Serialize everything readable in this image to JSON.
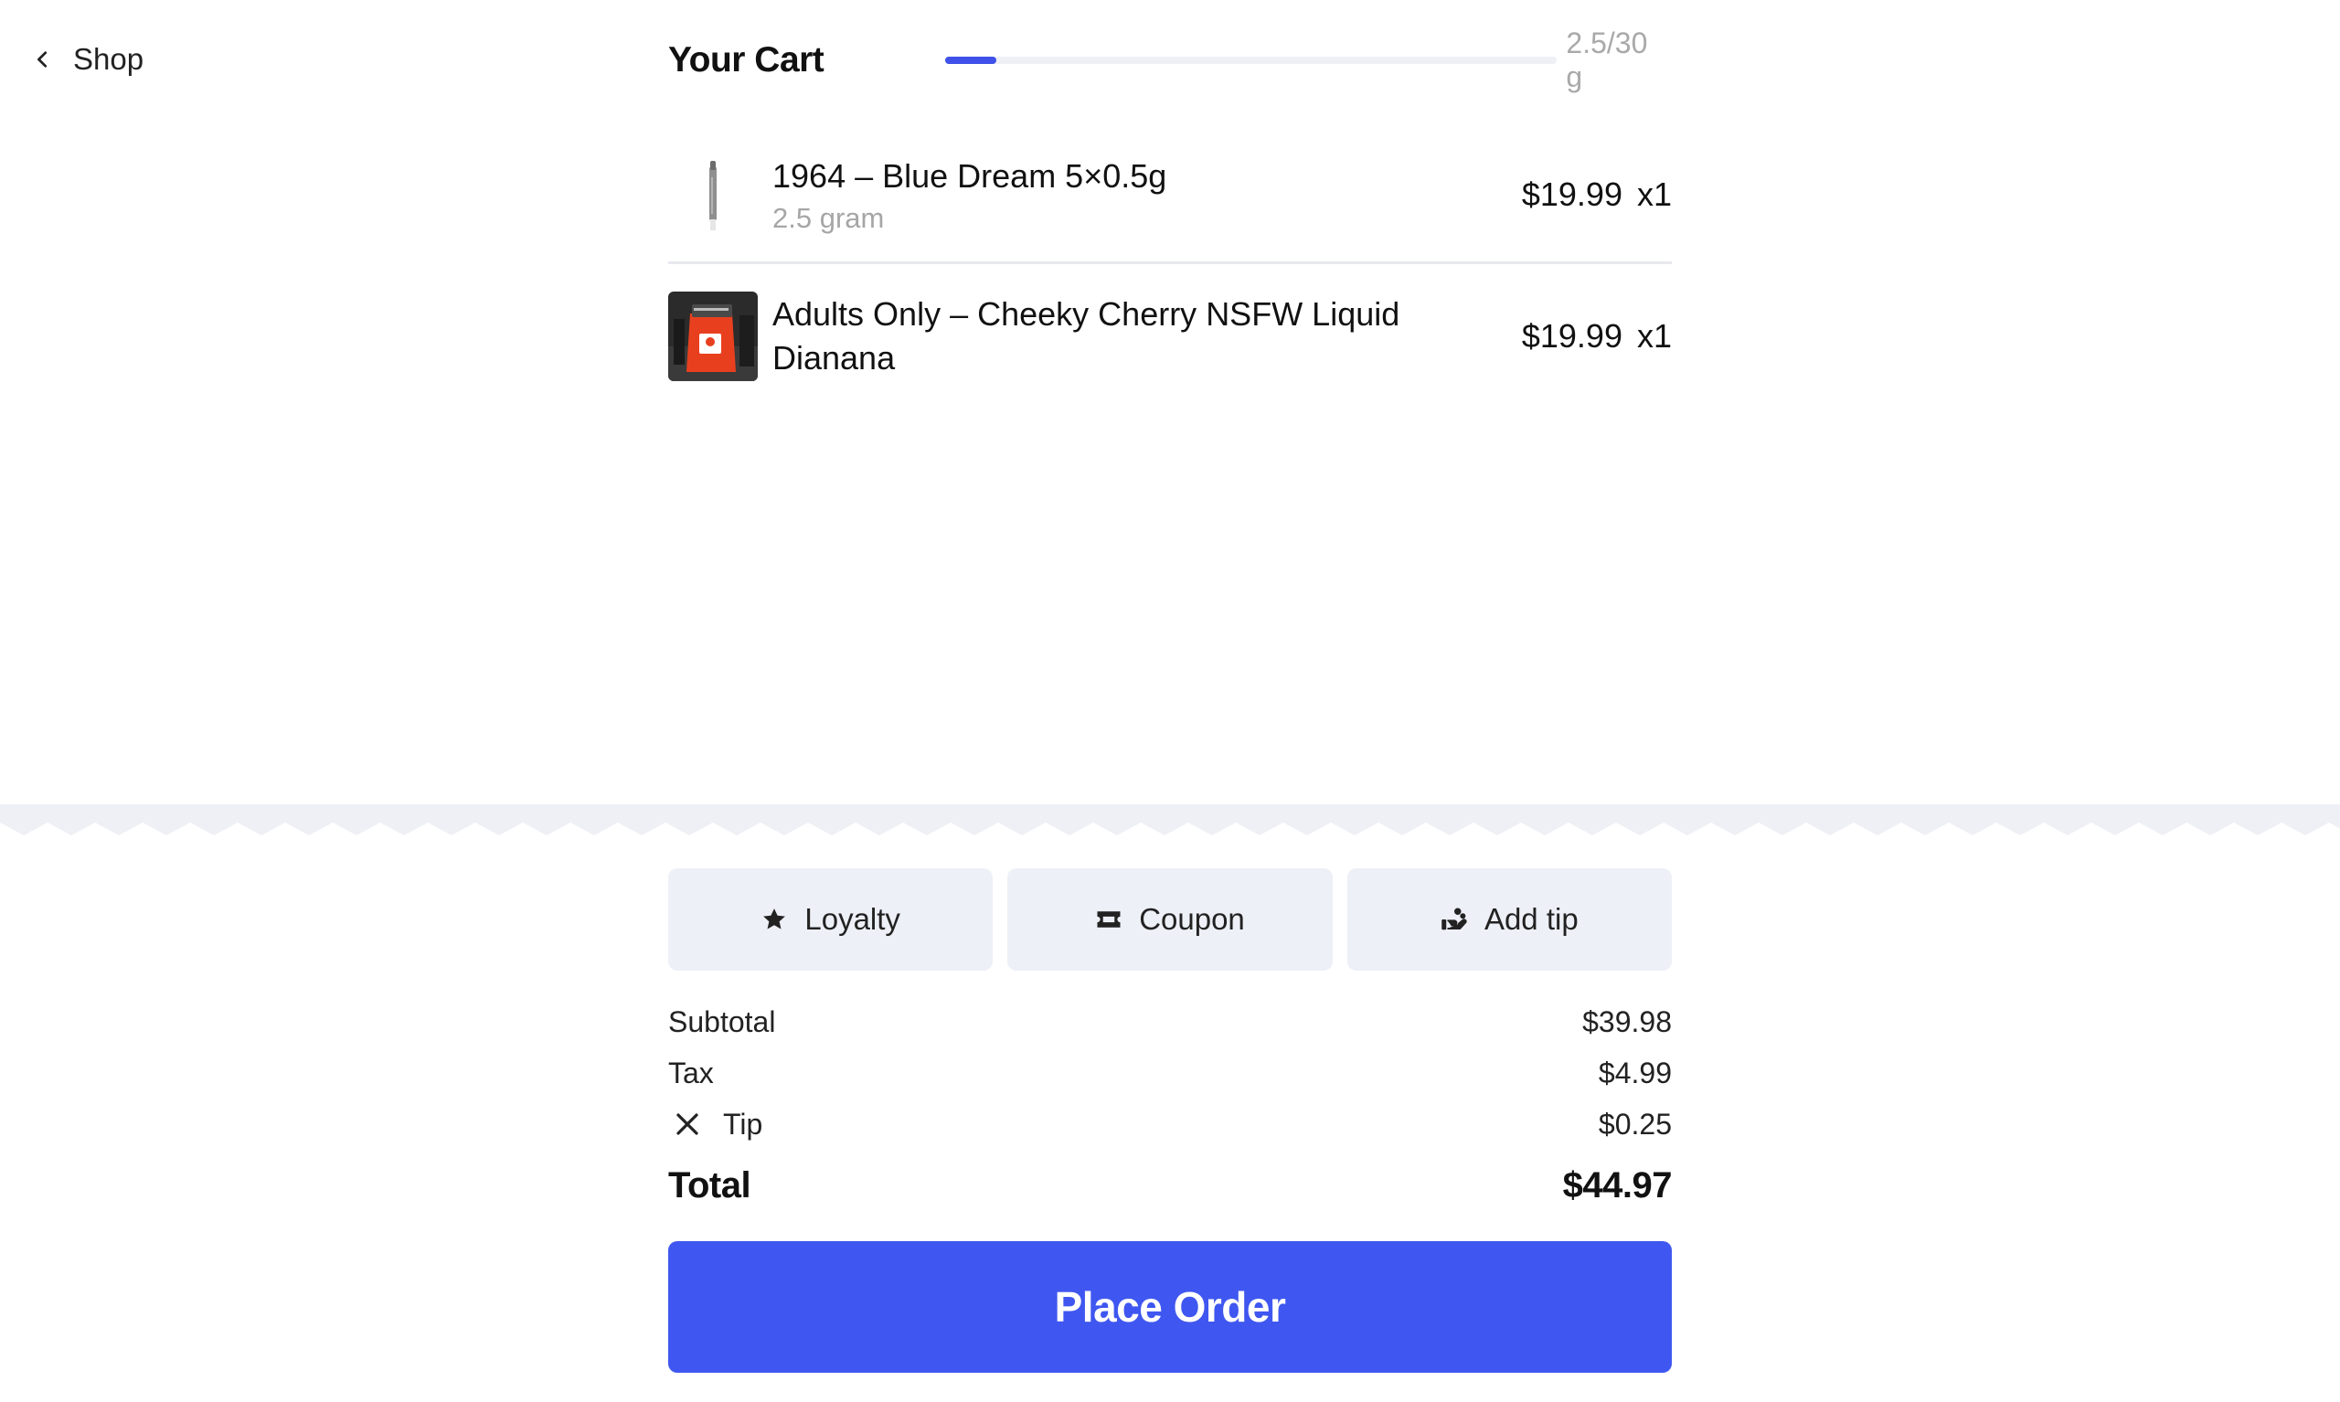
{
  "nav": {
    "back_label": "Shop"
  },
  "header": {
    "title": "Your Cart",
    "weight_text": "2.5/30 g",
    "weight_progress": 0.0833,
    "accent": "#3f51e8"
  },
  "items": [
    {
      "name": "1964 – Blue Dream 5×0.5g",
      "sub": "2.5 gram",
      "price": "$19.99",
      "qty": "x1",
      "thumb_icon": "pre-roll-image"
    },
    {
      "name": "Adults Only – Cheeky Cherry NSFW Liquid Dianana",
      "sub": "",
      "price": "$19.99",
      "qty": "x1",
      "thumb_icon": "product-bag-image"
    }
  ],
  "actions": {
    "loyalty": "Loyalty",
    "coupon": "Coupon",
    "tip": "Add tip"
  },
  "summary": {
    "subtotal_label": "Subtotal",
    "subtotal": "$39.98",
    "tax_label": "Tax",
    "tax": "$4.99",
    "tip_label": "Tip",
    "tip": "$0.25",
    "total_label": "Total",
    "total": "$44.97"
  },
  "place_order": {
    "label": "Place Order",
    "color": "#3f57f0"
  }
}
